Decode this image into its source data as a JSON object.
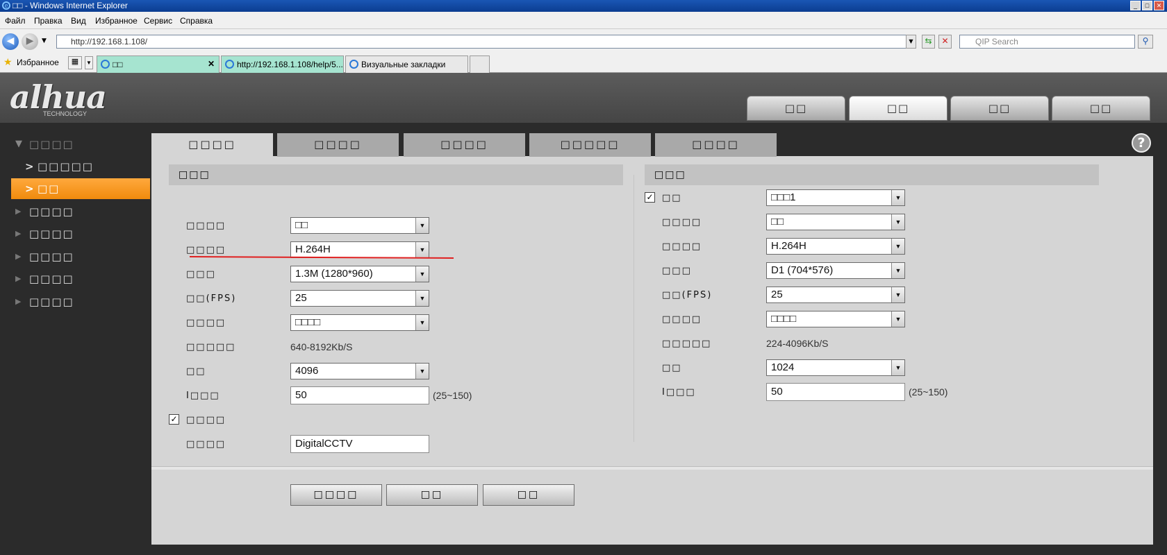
{
  "window": {
    "title": "□□ - Windows Internet Explorer",
    "min": "_",
    "max": "□",
    "close": "✕"
  },
  "menu": [
    "Файл",
    "Правка",
    "Вид",
    "Избранное",
    "Сервис",
    "Справка"
  ],
  "address": {
    "url": "http://192.168.1.108/",
    "search_placeholder": "QIP Search"
  },
  "favorites_label": "Избранное",
  "browser_tabs": [
    {
      "label": "□□"
    },
    {
      "label": "http://192.168.1.108/help/5..."
    },
    {
      "label": "Визуальные закладки"
    },
    {
      "label": ""
    }
  ],
  "logo": {
    "brand": "alhua",
    "sub": "TECHNOLOGY"
  },
  "top_tabs": [
    "□□",
    "□□",
    "□□",
    "□□"
  ],
  "sidebar": {
    "group_open": "□□□□",
    "items_sub": [
      {
        "label": "□□□□□"
      },
      {
        "label": "□□"
      }
    ],
    "groups": [
      "□□□□",
      "□□□□",
      "□□□□",
      "□□□□",
      "□□□□"
    ]
  },
  "content_tabs": [
    "□□□□",
    "□□□□",
    "□□□□",
    "□□□□□",
    "□□□□"
  ],
  "help_label": "?",
  "main_stream": {
    "header": "□□□",
    "rows": [
      {
        "label": "□□□□",
        "value": "□□"
      },
      {
        "label": "□□□□",
        "value": "H.264H"
      },
      {
        "label": "□□□",
        "value": "1.3M (1280*960)"
      },
      {
        "label": "□□(FPS)",
        "value": "25"
      },
      {
        "label": "□□□□",
        "value": "□□□□"
      },
      {
        "label": "□□□□□",
        "value": "640-8192Kb/S"
      },
      {
        "label": "□□",
        "value": "4096"
      },
      {
        "label": "I□□□",
        "value": "50"
      }
    ],
    "iframe_hint": "(25~150)",
    "watermark_label": "□□□□",
    "watermark_checked": "✓",
    "watermark_text_label": "□□□□",
    "watermark_text": "DigitalCCTV"
  },
  "sub_stream": {
    "header": "□□□",
    "enable_label": "□□",
    "enable_checked": "✓",
    "rows": [
      {
        "label": "",
        "value": "□□□1"
      },
      {
        "label": "□□□□",
        "value": "□□"
      },
      {
        "label": "□□□□",
        "value": "H.264H"
      },
      {
        "label": "□□□",
        "value": "D1 (704*576)"
      },
      {
        "label": "□□(FPS)",
        "value": "25"
      },
      {
        "label": "□□□□",
        "value": "□□□□"
      },
      {
        "label": "□□□□□",
        "value": "224-4096Kb/S"
      },
      {
        "label": "□□",
        "value": "1024"
      },
      {
        "label": "I□□□",
        "value": "50"
      }
    ],
    "iframe_hint": "(25~150)"
  },
  "buttons": [
    "□□□□",
    "□□",
    "□□"
  ],
  "colors": {
    "accent": "#f39218",
    "annotation": "#e02020"
  }
}
